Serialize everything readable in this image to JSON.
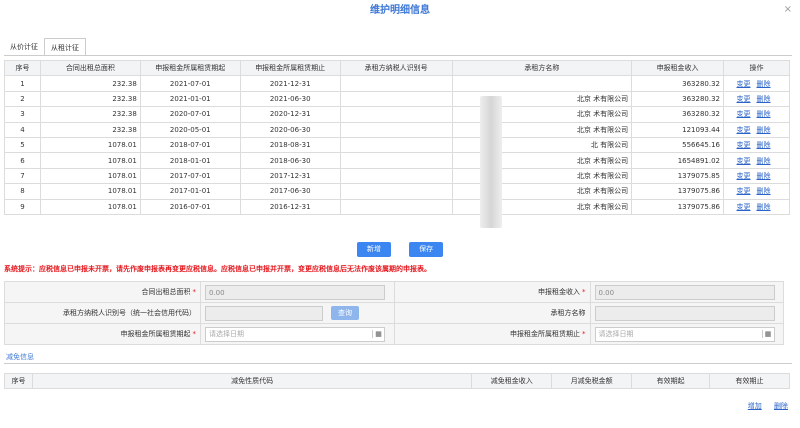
{
  "dialog": {
    "title": "维护明细信息",
    "close": "×"
  },
  "tabs": [
    "从价计征",
    "从租计征"
  ],
  "table": {
    "headers": [
      "序号",
      "合同出租总面积",
      "申报租金所属租赁期起",
      "申报租金所属租赁期止",
      "承租方纳税人识别号",
      "承租方名称",
      "申报租金收入",
      "操作"
    ],
    "rows": [
      [
        "1",
        "232.38",
        "2021-07-01",
        "2021-12-31",
        "",
        "",
        "363280.32"
      ],
      [
        "2",
        "232.38",
        "2021-01-01",
        "2021-06-30",
        "",
        "北京       术有限公司",
        "363280.32"
      ],
      [
        "3",
        "232.38",
        "2020-07-01",
        "2020-12-31",
        "",
        "北京       术有限公司",
        "363280.32"
      ],
      [
        "4",
        "232.38",
        "2020-05-01",
        "2020-06-30",
        "",
        "北京       术有限公司",
        "121093.44"
      ],
      [
        "5",
        "1078.01",
        "2018-07-01",
        "2018-08-31",
        "",
        "北       有限公司",
        "556645.16"
      ],
      [
        "6",
        "1078.01",
        "2018-01-01",
        "2018-06-30",
        "",
        "北京       术有限公司",
        "1654891.02"
      ],
      [
        "7",
        "1078.01",
        "2017-07-01",
        "2017-12-31",
        "",
        "北京       术有限公司",
        "1379075.85"
      ],
      [
        "8",
        "1078.01",
        "2017-01-01",
        "2017-06-30",
        "",
        "北京       术有限公司",
        "1379075.86"
      ],
      [
        "9",
        "1078.01",
        "2016-07-01",
        "2016-12-31",
        "",
        "北京       术有限公司",
        "1379075.86"
      ]
    ],
    "op_edit": "变更",
    "op_delete": "删除"
  },
  "buttons": {
    "add": "新增",
    "save": "保存"
  },
  "hint": "系统提示：应税信息已申报未开票，请先作废申报表再变更应税信息。应税信息已申报并开票，变更应税信息后无法作废该属期的申报表。",
  "form": {
    "area_label": "合同出租总面积",
    "area_value": "0.00",
    "income_label": "申报租金收入",
    "income_value": "0.00",
    "taxid_label": "承租方纳税人识别号（统一社会信用代码）",
    "query_btn": "查询",
    "name_label": "承租方名称",
    "start_label": "申报租金所属租赁期起",
    "end_label": "申报租金所属租赁期止",
    "date_placeholder": "请选择日期",
    "required_mark": "*"
  },
  "relief": {
    "tab": "减免信息",
    "headers": [
      "序号",
      "减免性质代码",
      "减免租金收入",
      "月减免税金额",
      "有效期起",
      "有效期止"
    ],
    "add": "增加",
    "delete": "删除"
  }
}
